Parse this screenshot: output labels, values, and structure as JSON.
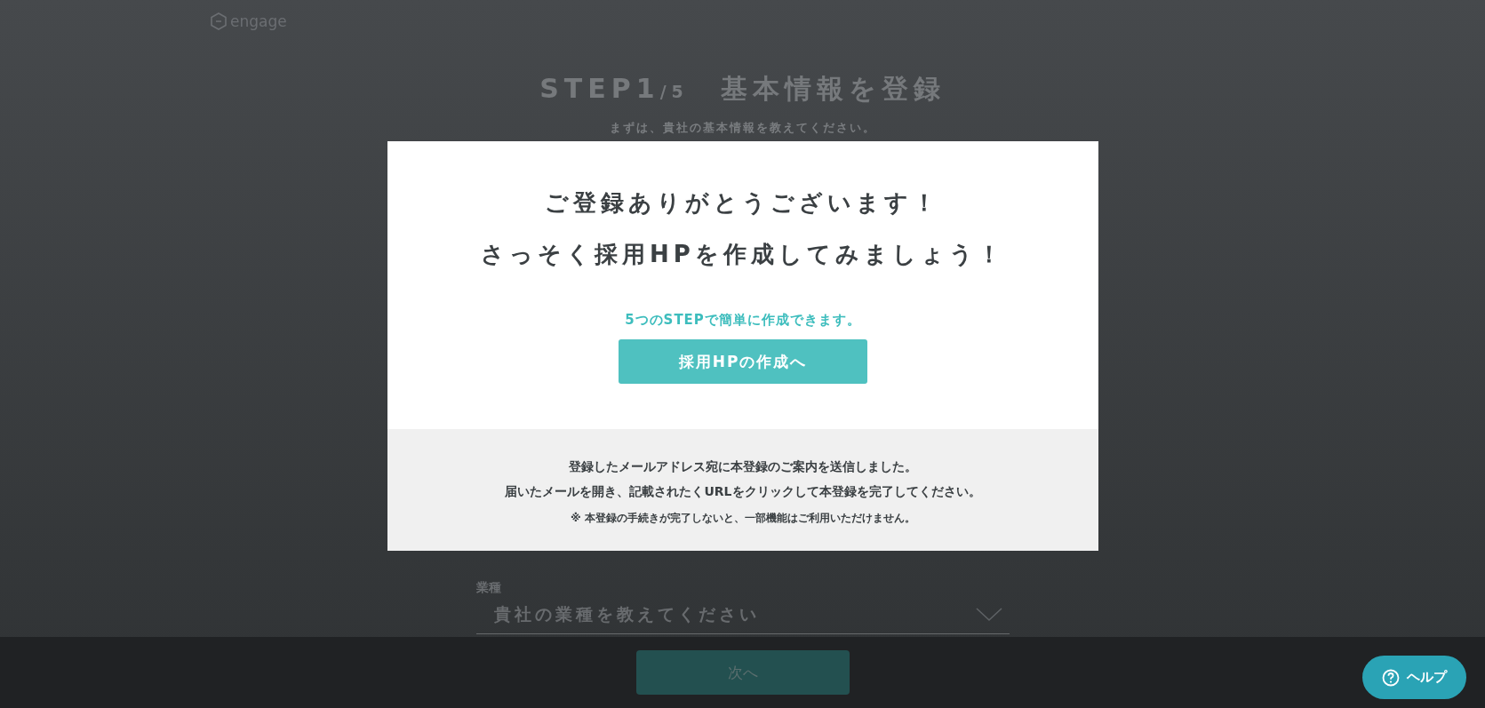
{
  "header": {
    "logo": "engage"
  },
  "page": {
    "title_step": "STEP1",
    "title_total": "/5",
    "title": "基本情報を登録",
    "subtitle": "まずは、貴社の基本情報を教えてください。"
  },
  "form": {
    "label": "業種",
    "placeholder": "貴社の業種を教えてください"
  },
  "footer": {
    "next_button": "次へ"
  },
  "help_button": {
    "label": "ヘルプ"
  },
  "modal": {
    "title_lines": [
      "ご登録ありがとうございます！",
      "さっそく採用HPを作成してみましょう！"
    ],
    "lead": "5つのSTEPで簡単に作成できます。",
    "button": "採用HPの作成へ",
    "notes": [
      "登録したメールアドレス宛に本登録のご案内を送信しました。",
      "届いたメールを開き、記載されたくURLをクリックして本登録を完了してください。"
    ],
    "caution": "※ 本登録の手続きが完了しないと、一部機能はご利用いただけません。"
  }
}
